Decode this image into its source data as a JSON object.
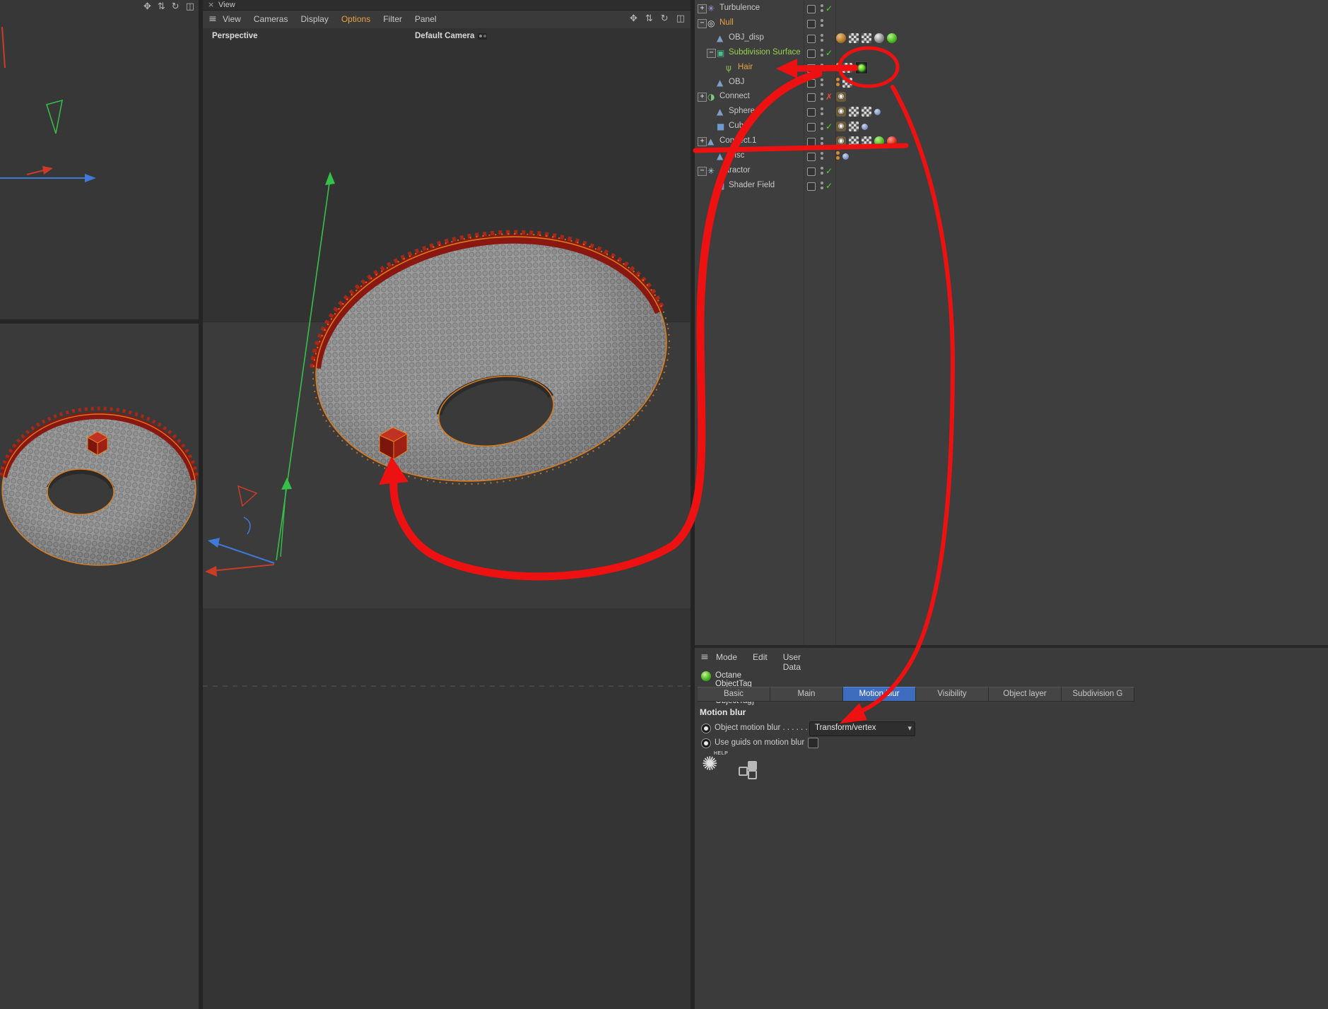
{
  "viewport": {
    "tab": "View",
    "close": "×",
    "menu": [
      "View",
      "Cameras",
      "Display",
      "Options",
      "Filter",
      "Panel"
    ],
    "menu_active": "Options",
    "perspective_label": "Perspective",
    "camera_label": "Default Camera"
  },
  "glyphs": {
    "hamburger": "≡",
    "pan": "✥",
    "updown": "⇅",
    "rotate": "↻",
    "split": "◫",
    "chevron": "▾",
    "check": "✓",
    "cross": "✗",
    "eye": "◉",
    "octane_logo": "✺",
    "tree": {
      "turbulence": {
        "g": "✳",
        "c": "#b49ae8"
      },
      "null": {
        "g": "◎",
        "c": "#e0e0e0"
      },
      "axis": {
        "g": "▲",
        "c": "#7f9fc6"
      },
      "sds": {
        "g": "▣",
        "c": "#45c08a"
      },
      "hair": {
        "g": "ψ",
        "c": "#86b954"
      },
      "connect": {
        "g": "◑",
        "c": "#7ec87e"
      },
      "cube": {
        "g": "■",
        "c": "#6f9ad0"
      },
      "attractor": {
        "g": "✳",
        "c": "#9fd3e0"
      },
      "shaderfield": {
        "g": "▦",
        "c": "#b0a0e0"
      }
    }
  },
  "tree": {
    "items": [
      {
        "label": "Turbulence",
        "indent": 0,
        "exp": "plus",
        "icon": "turbulence",
        "status": [
          "check"
        ],
        "tags": []
      },
      {
        "label": "Null",
        "color": "orange",
        "indent": 0,
        "exp": "minus",
        "icon": "null",
        "status": [],
        "tags": []
      },
      {
        "label": "OBJ_disp",
        "indent": 1,
        "icon": "axis",
        "status": [],
        "tags": [
          "texball",
          "checker",
          "checker",
          "grayball",
          "greenball"
        ]
      },
      {
        "label": "Subdivision Surface",
        "color": "green",
        "indent": 1,
        "exp": "minus",
        "icon": "sds",
        "status": [
          "check"
        ],
        "tags": []
      },
      {
        "label": "Hair",
        "color": "orange",
        "indent": 2,
        "icon": "hair",
        "status": [],
        "tags": [
          "orangedot",
          "checker",
          "octtag"
        ]
      },
      {
        "label": "OBJ",
        "indent": 1,
        "icon": "axis",
        "status": [],
        "tags": [
          "orangedot",
          "checker"
        ]
      },
      {
        "label": "Connect",
        "indent": 0,
        "exp": "plus",
        "icon": "connect",
        "status": [
          "x"
        ],
        "tags": [
          "eye"
        ]
      },
      {
        "label": "Sphere",
        "indent": 1,
        "icon": "axis",
        "status": [],
        "tags": [
          "eye",
          "checker",
          "checker",
          "bluedot"
        ]
      },
      {
        "label": "Cube",
        "indent": 1,
        "icon": "cube",
        "status": [
          "check"
        ],
        "tags": [
          "eye",
          "checker",
          "bluedot"
        ]
      },
      {
        "label": "Connect.1",
        "indent": 0,
        "exp": "plus",
        "icon": "axis",
        "status": [],
        "tags": [
          "eye",
          "checker",
          "checker",
          "greenball",
          "redball"
        ]
      },
      {
        "label": "Disc",
        "indent": 1,
        "icon": "axis",
        "status": [],
        "tags": [
          "orangedot",
          "bluedot"
        ]
      },
      {
        "label": "Attractor",
        "indent": 0,
        "exp": "minus",
        "icon": "attractor",
        "status": [
          "check"
        ],
        "tags": []
      },
      {
        "label": "Shader Field",
        "indent": 1,
        "icon": "shaderfield",
        "status": [
          "check"
        ],
        "tags": []
      }
    ]
  },
  "attributes": {
    "menu": [
      "Mode",
      "Edit",
      "User Data"
    ],
    "title": "Octane ObjectTag [Octane ObjectTag]",
    "tabs": [
      "Basic",
      "Main",
      "Motion blur",
      "Visibility",
      "Object layer",
      "Subdivision G"
    ],
    "active_tab": "Motion blur",
    "section": "Motion blur",
    "row1_label": "Object motion blur . . . . . .",
    "row1_value": "Transform/vertex",
    "row2_label": "Use guids on motion blur",
    "help_label": "HELP"
  },
  "colors": {
    "annotation_red": "#ee1111",
    "accent_orange": "#e8a33d",
    "selected_tab_blue": "#3e6dbf",
    "enabled_green": "#4ad628",
    "selection_outline_orange": "#d97b1f"
  }
}
